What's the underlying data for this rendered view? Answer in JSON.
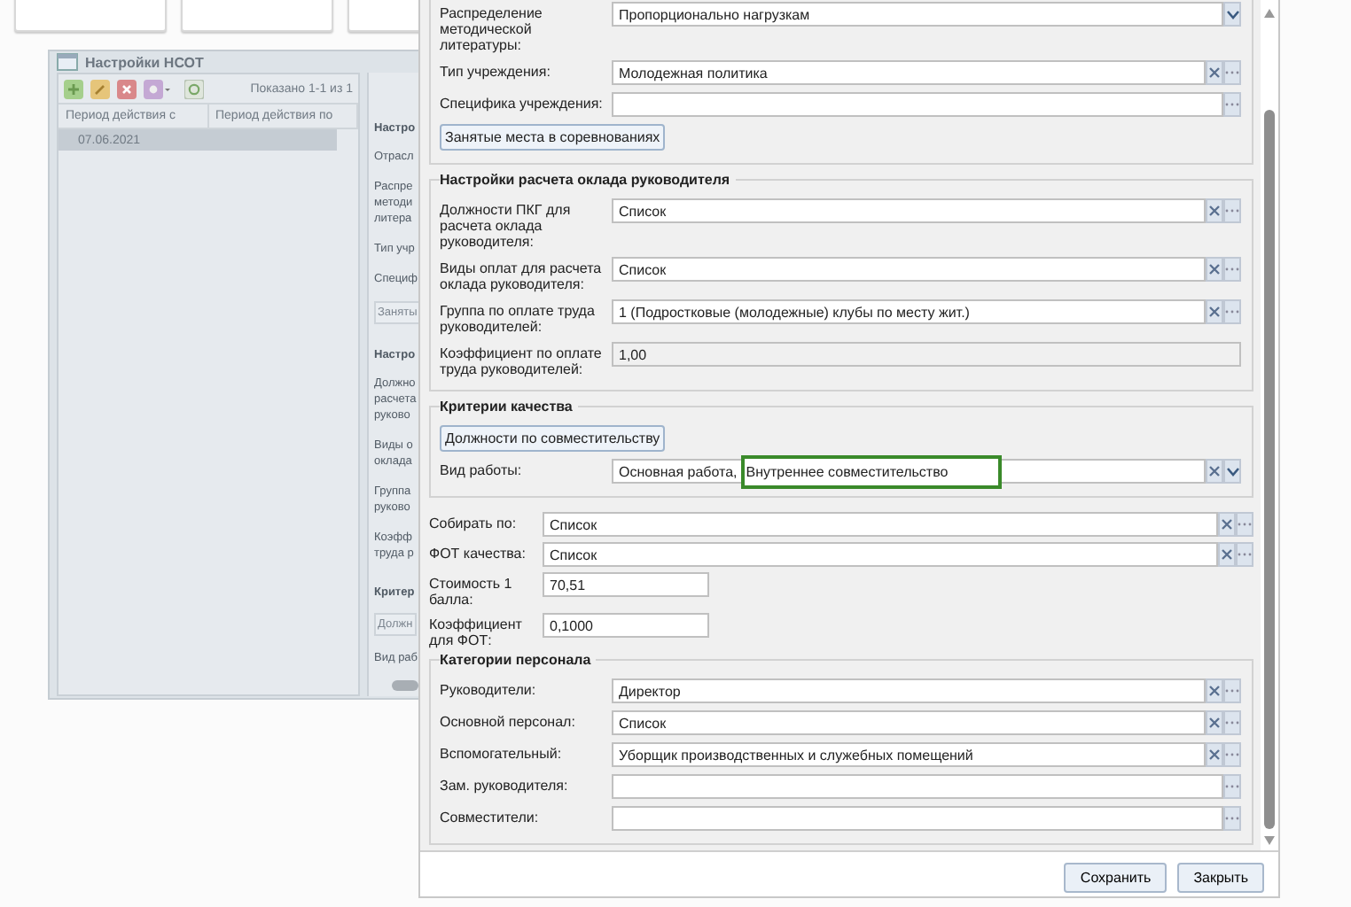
{
  "background_window": {
    "title": "Настройки НСОТ",
    "paging": "Показано 1-1 из 1",
    "columns": [
      "Период действия с",
      "Период действия по"
    ],
    "rows": [
      {
        "period_from": "07.06.2021",
        "selected": true
      }
    ],
    "side_items": [
      {
        "kind": "legend",
        "text": "Настро"
      },
      {
        "kind": "label",
        "text": "Отрасл"
      },
      {
        "kind": "label",
        "text": "Распре методи литера"
      },
      {
        "kind": "label",
        "text": "Тип учр"
      },
      {
        "kind": "label",
        "text": "Специф"
      },
      {
        "kind": "button",
        "text": "Заняты"
      },
      {
        "kind": "legend",
        "text": "Настро"
      },
      {
        "kind": "label",
        "text": "Должно расчета руково"
      },
      {
        "kind": "label",
        "text": "Виды о оклада"
      },
      {
        "kind": "label",
        "text": "Группа руково"
      },
      {
        "kind": "label",
        "text": "Коэфф труда р"
      },
      {
        "kind": "legend",
        "text": "Критер"
      },
      {
        "kind": "button",
        "text": "Должн"
      },
      {
        "kind": "label",
        "text": "Вид раб"
      }
    ]
  },
  "dialog": {
    "sections": [
      {
        "kind": "fieldset",
        "items": [
          {
            "kind": "combo",
            "label": "Распределение методической литературы:",
            "value": "Пропорционально нагрузкам"
          },
          {
            "kind": "lookup",
            "label": "Тип учреждения:",
            "value": "Молодежная политика"
          },
          {
            "kind": "lookup",
            "label": "Специфика учреждения:"
          },
          {
            "kind": "button",
            "label": "Занятые места в соревнованиях"
          }
        ]
      },
      {
        "kind": "fieldset",
        "legend": "Настройки расчета оклада руководителя",
        "items": [
          {
            "kind": "lookup",
            "label": "Должности ПКГ для расчета оклада руководителя:",
            "value": "Список"
          },
          {
            "kind": "lookup",
            "label": "Виды оплат для расчета оклада руководителя:",
            "value": "Список"
          },
          {
            "kind": "lookup",
            "label": "Группа по оплате труда руководителей:",
            "value": "1 (Подростковые (молодежные) клубы по месту жит.)"
          },
          {
            "kind": "readonly",
            "label": "Коэффициент по оплате труда руководителей:",
            "value": "1,00"
          }
        ]
      },
      {
        "kind": "fieldset",
        "legend": "Критерии качества",
        "items": [
          {
            "kind": "button",
            "label": "Должности по совместительству"
          },
          {
            "kind": "multiselect",
            "label": "Вид работы:",
            "parts": [
              {
                "text": "Основная работа,",
                "highlighted": false
              },
              {
                "text": "Внутреннее совместительство",
                "highlighted": true
              }
            ]
          }
        ]
      },
      {
        "kind": "plain",
        "items": [
          {
            "kind": "lookup",
            "label": "Собирать по:",
            "value": "Список"
          },
          {
            "kind": "lookup",
            "label": "ФОТ качества:",
            "value": "Список"
          },
          {
            "kind": "number",
            "label": "Стоимость 1 балла:",
            "value": "70,51"
          },
          {
            "kind": "number",
            "label": "Коэффициент для ФОТ:",
            "value": "0,1000"
          }
        ]
      },
      {
        "kind": "fieldset",
        "legend": "Категории персонала",
        "items": [
          {
            "kind": "lookup",
            "label": "Руководители:",
            "value": "Директор"
          },
          {
            "kind": "lookup",
            "label": "Основной персонал:",
            "value": "Список"
          },
          {
            "kind": "lookup",
            "label": "Вспомогательный:",
            "value": "Уборщик производственных и служебных помещений"
          },
          {
            "kind": "lookup",
            "label": "Зам. руководителя:"
          },
          {
            "kind": "lookup",
            "label": "Совместители:"
          }
        ]
      }
    ],
    "buttons": [
      "Сохранить",
      "Закрыть"
    ]
  }
}
